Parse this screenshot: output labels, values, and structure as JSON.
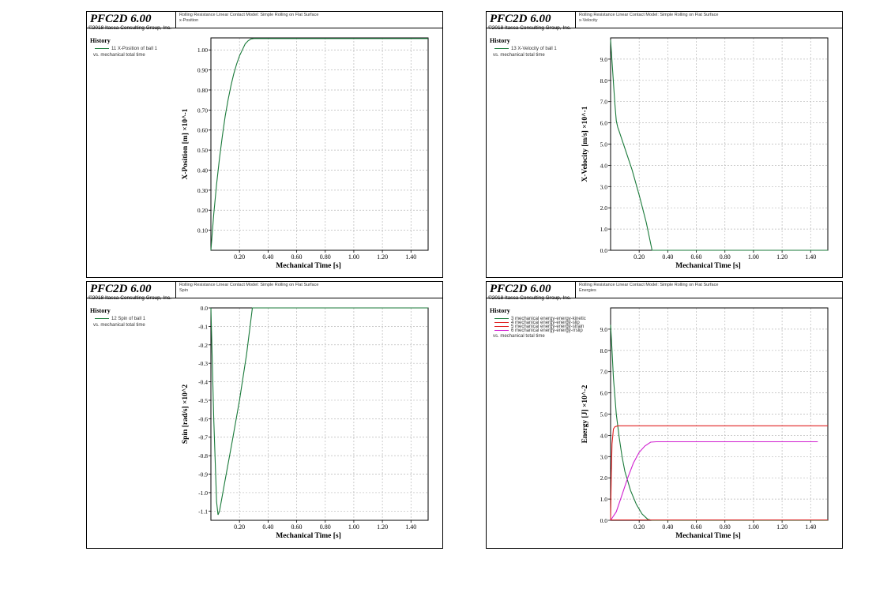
{
  "software": {
    "title": "PFC2D 6.00",
    "copyright": "©2018 Itasca Consulting Group, Inc."
  },
  "colors": {
    "green": "#1a7a3a",
    "red": "#e02020",
    "magenta": "#d020d0",
    "grid": "#b8b8b8"
  },
  "panels": [
    {
      "project": "Rolling Resistance Linear Contact Model: Simple Rolling on Flat Surface",
      "subtitle": "x-Position",
      "history": "History",
      "vs": "vs. mechanical total time",
      "legend": [
        {
          "label": "11 X-Position of ball 1",
          "color": "#1a7a3a"
        }
      ]
    },
    {
      "project": "Rolling Resistance Linear Contact Model: Simple Rolling on Flat Surface",
      "subtitle": "x-Velocity",
      "history": "History",
      "vs": "vs. mechanical total time",
      "legend": [
        {
          "label": "13 X-Velocity of ball 1",
          "color": "#1a7a3a"
        }
      ]
    },
    {
      "project": "Rolling Resistance Linear Contact Model: Simple Rolling on Flat Surface",
      "subtitle": "Spin",
      "history": "History",
      "vs": "vs. mechanical total time",
      "legend": [
        {
          "label": "12 Spin of ball 1",
          "color": "#1a7a3a"
        }
      ]
    },
    {
      "project": "Rolling Resistance Linear Contact Model: Simple Rolling on Flat Surface",
      "subtitle": "Energies",
      "history": "History",
      "vs": "vs. mechanical total time",
      "legend": [
        {
          "label": "3 mechanical energy-energy-kinetic",
          "color": "#1a7a3a"
        },
        {
          "label": "4 mechanical energy-energy-slip",
          "color": "#e02020"
        },
        {
          "label": "5 mechanical energy-energy-strain",
          "color": "#e02020"
        },
        {
          "label": "6 mechanical energy-energy-rrslip",
          "color": "#d020d0"
        }
      ]
    }
  ],
  "chart_data": [
    {
      "type": "line",
      "xlabel": "Mechanical Time [s]",
      "ylabel": "X-Position [m] ×10^-1",
      "xlim": [
        0,
        1.52
      ],
      "ylim": [
        0,
        1.06
      ],
      "xticks": [
        0.2,
        0.4,
        0.6,
        0.8,
        1.0,
        1.2,
        1.4
      ],
      "xtick_labels": [
        "0.20",
        "0.40",
        "0.60",
        "0.80",
        "1.00",
        "1.20",
        "1.40"
      ],
      "yticks": [
        0.1,
        0.2,
        0.3,
        0.4,
        0.5,
        0.6,
        0.7,
        0.8,
        0.9,
        1.0
      ],
      "ytick_labels": [
        "0.10",
        "0.20",
        "0.30",
        "0.40",
        "0.50",
        "0.60",
        "0.70",
        "0.80",
        "0.90",
        "1.00"
      ],
      "grid": true,
      "series": [
        {
          "color": "#1a7a3a",
          "x": [
            0,
            0.02,
            0.04,
            0.06,
            0.08,
            0.1,
            0.12,
            0.14,
            0.16,
            0.18,
            0.2,
            0.22,
            0.24,
            0.26,
            0.28,
            0.3,
            1.52
          ],
          "y": [
            0,
            0.18,
            0.33,
            0.46,
            0.57,
            0.67,
            0.75,
            0.82,
            0.88,
            0.93,
            0.97,
            1.0,
            1.03,
            1.045,
            1.055,
            1.057,
            1.057
          ]
        }
      ]
    },
    {
      "type": "line",
      "xlabel": "Mechanical Time [s]",
      "ylabel": "X-Velocity [m/s] ×10^-1",
      "xlim": [
        0,
        1.52
      ],
      "ylim": [
        0,
        10
      ],
      "xticks": [
        0.2,
        0.4,
        0.6,
        0.8,
        1.0,
        1.2,
        1.4
      ],
      "xtick_labels": [
        "0.20",
        "0.40",
        "0.60",
        "0.80",
        "1.00",
        "1.20",
        "1.40"
      ],
      "yticks": [
        0,
        1,
        2,
        3,
        4,
        5,
        6,
        7,
        8,
        9
      ],
      "ytick_labels": [
        "0.0",
        "1.0",
        "2.0",
        "3.0",
        "4.0",
        "5.0",
        "6.0",
        "7.0",
        "8.0",
        "9.0"
      ],
      "grid": true,
      "series": [
        {
          "color": "#1a7a3a",
          "x": [
            0,
            0.01,
            0.02,
            0.03,
            0.04,
            0.05,
            0.06,
            0.1,
            0.15,
            0.2,
            0.25,
            0.29,
            1.52
          ],
          "y": [
            9.9,
            8.9,
            7.9,
            6.9,
            6.1,
            5.8,
            5.6,
            4.8,
            3.8,
            2.6,
            1.3,
            0.0,
            0.0
          ]
        }
      ]
    },
    {
      "type": "line",
      "xlabel": "Mechanical Time [s]",
      "ylabel": "Spin [rad/s] ×10^2",
      "xlim": [
        0,
        1.52
      ],
      "ylim": [
        -1.15,
        0
      ],
      "xticks": [
        0.2,
        0.4,
        0.6,
        0.8,
        1.0,
        1.2,
        1.4
      ],
      "xtick_labels": [
        "0.20",
        "0.40",
        "0.60",
        "0.80",
        "1.00",
        "1.20",
        "1.40"
      ],
      "yticks": [
        0,
        -0.1,
        -0.2,
        -0.3,
        -0.4,
        -0.5,
        -0.6,
        -0.7,
        -0.8,
        -0.9,
        -1.0,
        -1.1
      ],
      "ytick_labels": [
        "0.0",
        "-0.1",
        "-0.2",
        "-0.3",
        "-0.4",
        "-0.5",
        "-0.6",
        "-0.7",
        "-0.8",
        "-0.9",
        "-1.0",
        "-1.1"
      ],
      "grid": true,
      "series": [
        {
          "color": "#1a7a3a",
          "x": [
            0,
            0.02,
            0.04,
            0.05,
            0.06,
            0.1,
            0.15,
            0.2,
            0.25,
            0.29,
            1.52
          ],
          "y": [
            0,
            -0.6,
            -1.05,
            -1.12,
            -1.1,
            -0.93,
            -0.72,
            -0.5,
            -0.25,
            0.0,
            0.0
          ]
        }
      ]
    },
    {
      "type": "line",
      "xlabel": "Mechanical Time [s]",
      "ylabel": "Energy [J] ×10^-2",
      "xlim": [
        0,
        1.52
      ],
      "ylim": [
        0,
        10
      ],
      "xticks": [
        0.2,
        0.4,
        0.6,
        0.8,
        1.0,
        1.2,
        1.4
      ],
      "xtick_labels": [
        "0.20",
        "0.40",
        "0.60",
        "0.80",
        "1.00",
        "1.20",
        "1.40"
      ],
      "yticks": [
        0,
        1,
        2,
        3,
        4,
        5,
        6,
        7,
        8,
        9
      ],
      "ytick_labels": [
        "0.0",
        "1.0",
        "2.0",
        "3.0",
        "4.0",
        "5.0",
        "6.0",
        "7.0",
        "8.0",
        "9.0"
      ],
      "grid": true,
      "series": [
        {
          "color": "#1a7a3a",
          "x": [
            0,
            0.01,
            0.02,
            0.04,
            0.06,
            0.08,
            0.1,
            0.14,
            0.18,
            0.22,
            0.26,
            0.29,
            1.52
          ],
          "y": [
            9.2,
            8.0,
            6.7,
            5.0,
            3.9,
            3.0,
            2.3,
            1.4,
            0.75,
            0.3,
            0.05,
            0.0,
            0.0
          ]
        },
        {
          "color": "#e02020",
          "x": [
            0,
            0.005,
            0.01,
            0.02,
            0.03,
            0.05,
            1.52
          ],
          "y": [
            0,
            2.2,
            3.6,
            4.3,
            4.4,
            4.45,
            4.45
          ]
        },
        {
          "color": "#d020d0",
          "x": [
            0,
            0.04,
            0.08,
            0.12,
            0.16,
            0.2,
            0.24,
            0.28,
            0.32,
            1.45
          ],
          "y": [
            0,
            0.4,
            1.2,
            2.0,
            2.7,
            3.2,
            3.5,
            3.68,
            3.7,
            3.7
          ]
        },
        {
          "color": "#e02020",
          "x": [
            0,
            1.52
          ],
          "y": [
            0.02,
            0.02
          ]
        }
      ]
    }
  ]
}
